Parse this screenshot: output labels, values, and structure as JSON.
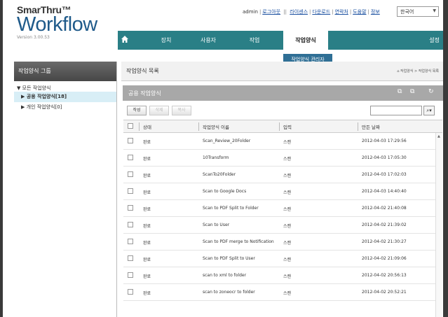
{
  "app": {
    "brand": "SmarThru™",
    "product": "Workflow",
    "version": "Version 3.00.53"
  },
  "util": {
    "user": "admin",
    "logout": "로그아웃",
    "divider": "||",
    "links": [
      "라이센스",
      "다운로드",
      "연락처",
      "도움말",
      "정보"
    ],
    "language": "한국어"
  },
  "nav": {
    "items": [
      "장치",
      "사용자",
      "작업",
      "작업양식"
    ],
    "settings": "설정",
    "submenu": "작업양식 관리자"
  },
  "sidebar": {
    "header": "작업양식 그룹",
    "root": "모든 작업양식",
    "items": [
      {
        "label": "공용 작업양식[18]",
        "selected": true
      },
      {
        "label": "개인 작업양식[0]",
        "selected": false
      }
    ]
  },
  "main": {
    "title": "작업양식 목록",
    "breadcrumb": "작업양식 > 작업양식 목록",
    "section": "공용 작업양식",
    "buttons": {
      "create": "작성",
      "delete": "삭제",
      "copy": "복사"
    },
    "search_value": ""
  },
  "table": {
    "columns": [
      "상태",
      "작업양식 이름",
      "입력",
      "만든 날짜"
    ],
    "rows": [
      {
        "status": "완료",
        "name": "Scan_Review_20Folder",
        "input": "스캔",
        "date": "2012-04-03 17:29:56"
      },
      {
        "status": "완료",
        "name": "10Transform",
        "input": "스캔",
        "date": "2012-04-03 17:05:30"
      },
      {
        "status": "완료",
        "name": "ScanTo20Folder",
        "input": "스캔",
        "date": "2012-04-03 17:02:03"
      },
      {
        "status": "완료",
        "name": "Scan to Google Docs",
        "input": "스캔",
        "date": "2012-04-03 14:40:40"
      },
      {
        "status": "완료",
        "name": "Scan to PDF Split to Folder",
        "input": "스캔",
        "date": "2012-04-02 21:40:08"
      },
      {
        "status": "완료",
        "name": "Scan to User",
        "input": "스캔",
        "date": "2012-04-02 21:39:02"
      },
      {
        "status": "완료",
        "name": "Scan to PDF merge to Notification",
        "input": "스캔",
        "date": "2012-04-02 21:30:27"
      },
      {
        "status": "완료",
        "name": "Scan to PDF Split to User",
        "input": "스캔",
        "date": "2012-04-02 21:09:06"
      },
      {
        "status": "완료",
        "name": "scan to xml to folder",
        "input": "스캔",
        "date": "2012-04-02 20:56:13"
      },
      {
        "status": "완료",
        "name": "scan to zoneocr to folder",
        "input": "스캔",
        "date": "2012-04-02 20:52:21"
      }
    ]
  },
  "colors": {
    "nav_bg": "#2a7f86",
    "submenu_bg": "#2f6f95",
    "selected_row": "#d8eef6",
    "logo_blue": "#1f5a8a"
  }
}
